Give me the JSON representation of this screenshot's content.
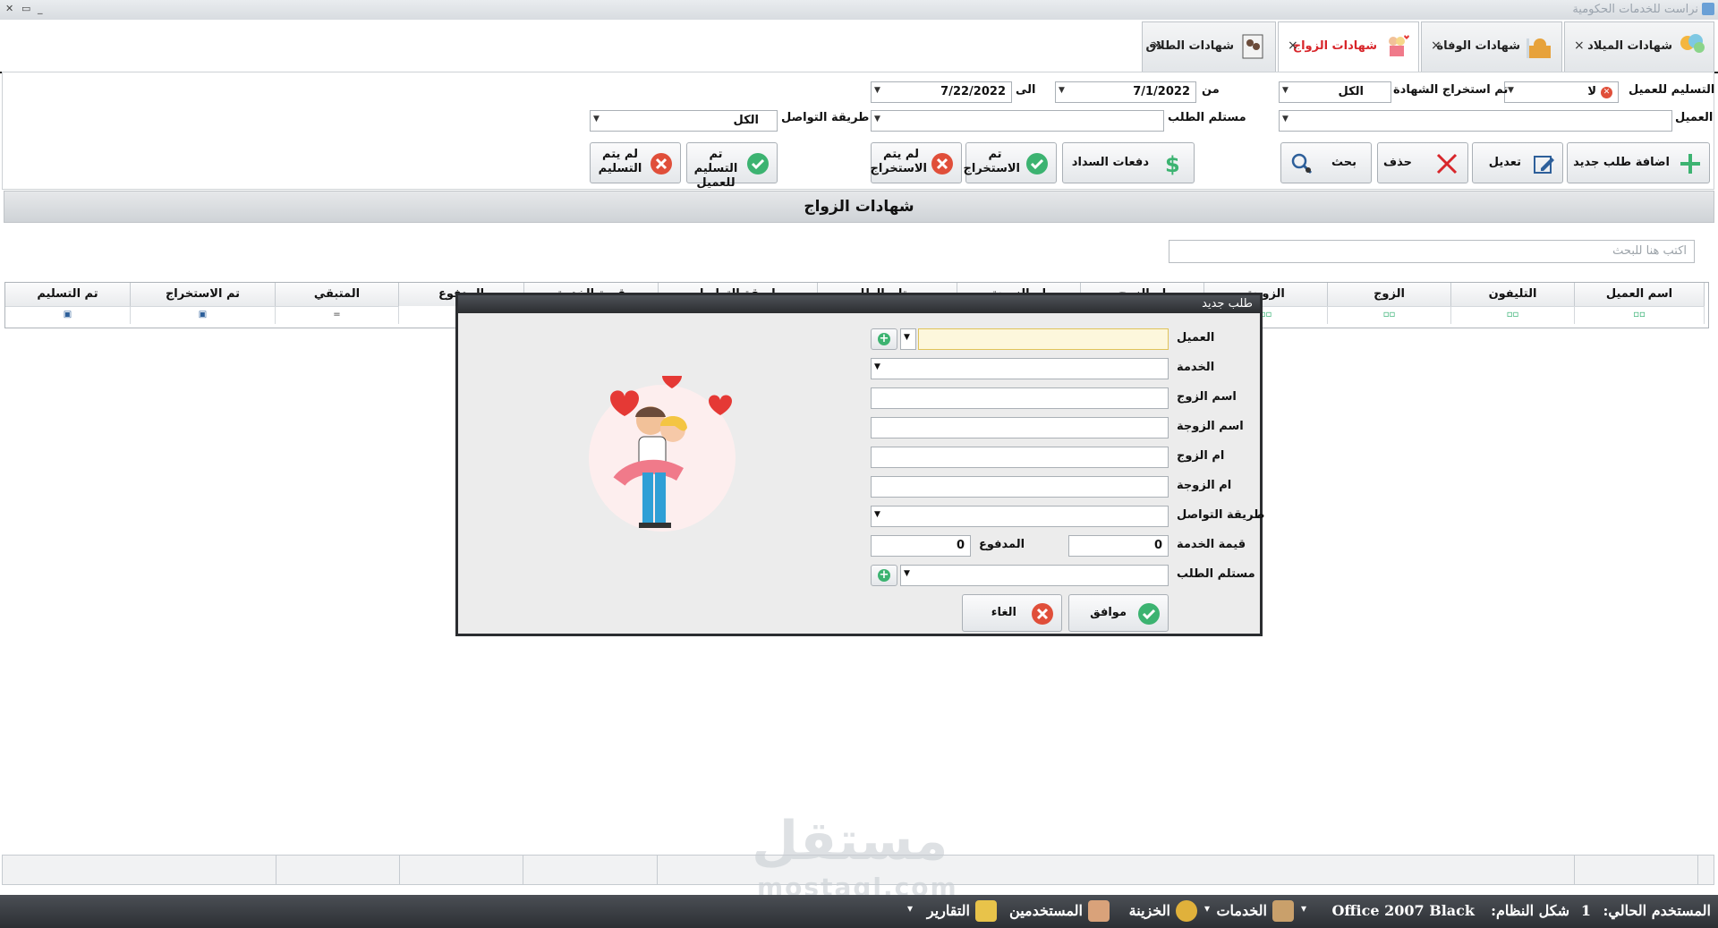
{
  "window": {
    "title": "نراست للخدمات الحكومية"
  },
  "tabs": [
    {
      "label": "شهادات الميلاد",
      "close": "×"
    },
    {
      "label": "شهادات الوفاة",
      "close": "×"
    },
    {
      "label": "شهادات الزواج",
      "close": "×"
    },
    {
      "label": "شهادات الطلاق",
      "close": "×"
    }
  ],
  "filters": {
    "delivered_label": "تم التسليم للعميل",
    "delivered_value": "لا",
    "extracted_label": "تم استخراج الشهادة",
    "extracted_value": "الكل",
    "from_label": "من",
    "from_value": "7/1/2022",
    "to_label": "الى",
    "to_value": "7/22/2022",
    "client_label": "العميل",
    "client_value": "",
    "receiver_label": "مستلم الطلب",
    "receiver_value": "",
    "contact_label": "طريقة التواصل",
    "contact_value": "الكل"
  },
  "toolbar": {
    "add": "اضافة طلب جديد",
    "edit": "تعديل",
    "delete": "حذف",
    "search": "بحث",
    "payments": "دفعات السداد",
    "extracted": "تم الاستخراج",
    "not_extracted": "لم يتم الاستخراج",
    "delivered": "تم التسليم للعميل",
    "not_delivered": "لم يتم التسليم"
  },
  "grid": {
    "title": "شهادات الزواج",
    "search_placeholder": "اكتب هنا للبحث",
    "columns": [
      "اسم العميل",
      "التليفون",
      "الزوج",
      "الزوجة",
      "ام الزوج",
      "ام الزوجة",
      "مستلم الطلب",
      "طريقة التواصل",
      "قيمة الخدمة",
      "المدفوع",
      "المتبقي",
      "تم الاستخراج",
      "تم التسليم"
    ]
  },
  "dialog": {
    "title": "طلب جديد",
    "client_label": "العميل",
    "service_label": "الخدمة",
    "husband_label": "اسم الزوج",
    "wife_label": "اسم الزوجة",
    "husband_mother_label": "ام الزوج",
    "wife_mother_label": "ام الزوجة",
    "contact_label": "طريقة التواصل",
    "service_value_label": "قيمة الخدمة",
    "service_value": "0",
    "paid_label": "المدفوع",
    "paid_value": "0",
    "receiver_label": "مستلم الطلب",
    "ok": "موافق",
    "cancel": "الغاء"
  },
  "status": {
    "current_user_label": "المستخدم الحالي:",
    "current_user_value": "1",
    "theme_label": "شكل النظام:",
    "theme_value": "Office 2007 Black",
    "services": "الخدمات",
    "treasury": "الخزينة",
    "users": "المستخدمين",
    "reports": "التقارير"
  },
  "watermark": {
    "text": "مستقل",
    "sub": "mostaql.com"
  },
  "colors": {
    "accent_red": "#d8262b",
    "green": "#3cb371",
    "status_bg": "#2c2f34"
  }
}
